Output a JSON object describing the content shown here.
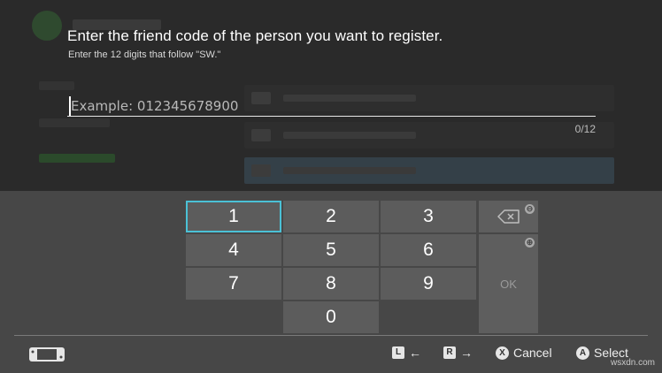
{
  "prompt": {
    "title": "Enter the friend code of the person you want to register.",
    "subtitle": "Enter the 12 digits that follow \"SW.\""
  },
  "field": {
    "value": "",
    "placeholder": "Example: 012345678900",
    "counter": "0/12"
  },
  "keypad": {
    "keys": [
      "1",
      "2",
      "3",
      "4",
      "5",
      "6",
      "7",
      "8",
      "9",
      "0"
    ],
    "focused_key": "1",
    "backspace_badge": "⊖",
    "ok_badge": "⊕",
    "ok_label": "OK"
  },
  "footer": {
    "l_button": "L",
    "l_arrow": "←",
    "r_button": "R",
    "r_arrow": "→",
    "x_button": "X",
    "cancel_label": "Cancel",
    "a_button": "A",
    "select_label": "Select"
  },
  "watermark": "wsxdn.com",
  "colors": {
    "focus_outline": "#4bc1d6",
    "panel": "#474747",
    "key": "#5c5c5c"
  }
}
